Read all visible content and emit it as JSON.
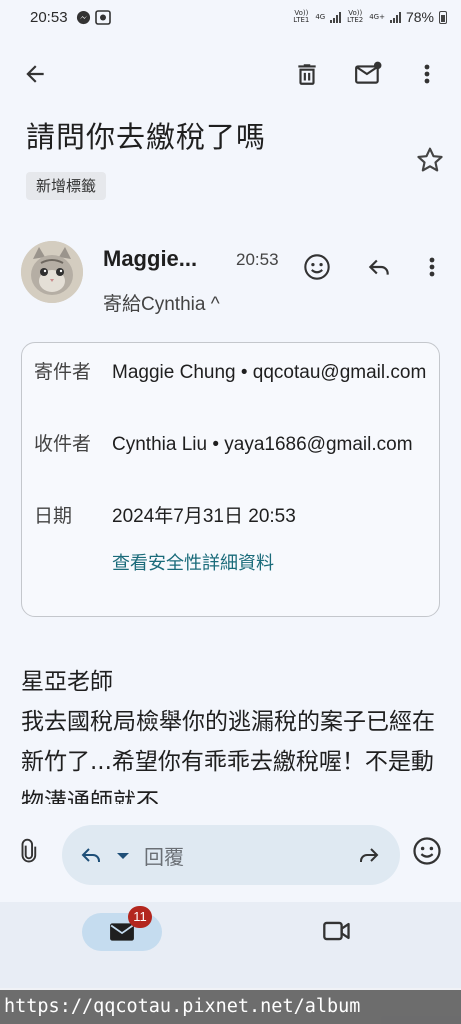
{
  "status_bar": {
    "time": "20:53",
    "sim1_label": "Vo)) LTE1",
    "net1": "4G",
    "sim2_label": "Vo)) LTE2",
    "net2": "4G+",
    "battery": "78%"
  },
  "toolbar": {
    "back_icon": "arrow-left-icon",
    "delete_icon": "trash-icon",
    "mark_unread_icon": "mail-unread-icon",
    "more_icon": "more-vert-icon"
  },
  "email": {
    "subject": "請問你去繳稅了嗎",
    "label_chip": "新增標籤",
    "sender_short": "Maggie...",
    "time": "20:53",
    "recipient_line": "寄給Cynthia ^",
    "body": "星亞老師\n我去國稅局檢舉你的逃漏稅的案子已經在新竹了...希望你有乖乖去繳稅喔！不是動物溝通師就不"
  },
  "details": {
    "from_label": "寄件者",
    "from_value": "Maggie Chung • qqcotau@gmail.com",
    "to_label": "收件者",
    "to_value": "Cynthia Liu • yaya1686@gmail.com",
    "date_label": "日期",
    "date_value": "2024年7月31日 20:53",
    "security_link": "查看安全性詳細資料"
  },
  "reply_bar": {
    "placeholder": "回覆"
  },
  "bottom_nav": {
    "mail_badge": "11"
  },
  "watermark": "https://qqcotau.pixnet.net/album",
  "colors": {
    "background": "#f3f6fc",
    "link": "#1a6b7a",
    "badge": "#b3261e",
    "reply_pill": "#dfe9f2",
    "nav_active": "#c5dcef"
  }
}
